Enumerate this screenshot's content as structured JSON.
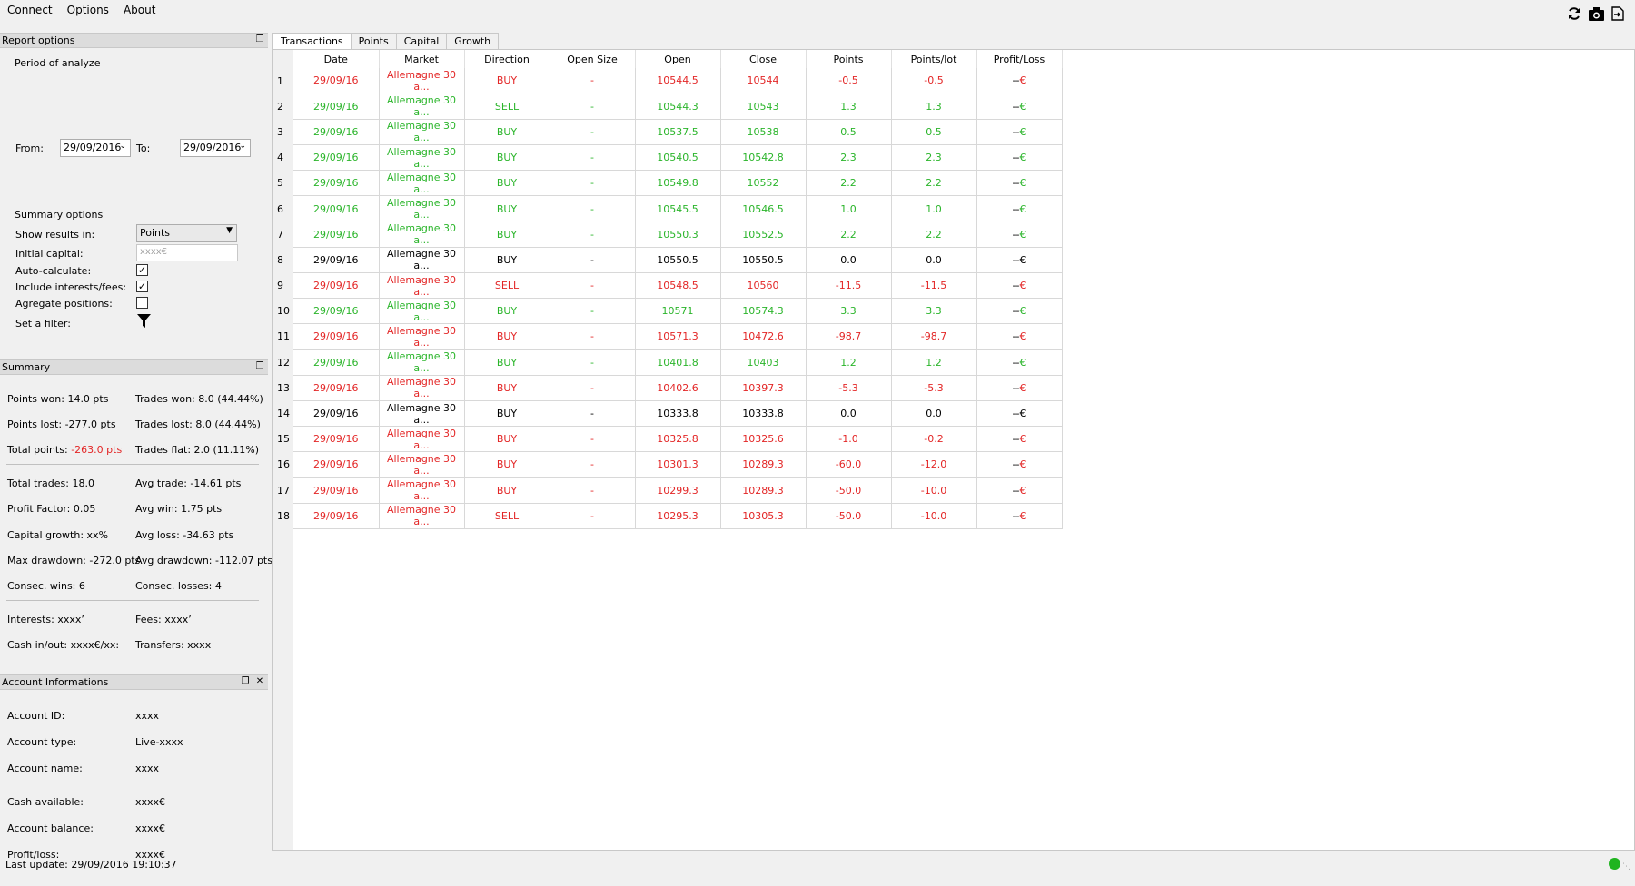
{
  "menu": [
    "Connect",
    "Options",
    "About"
  ],
  "toolbar": {
    "icons": [
      "refresh-icon",
      "camera-icon",
      "export-icon"
    ]
  },
  "report_options": {
    "title": "Report options",
    "period_label": "Period of analyze",
    "from_label": "From:",
    "from_value": "29/09/2016",
    "to_label": "To:",
    "to_value": "29/09/2016",
    "summary_options_label": "Summary options",
    "show_results_label": "Show results in:",
    "show_results_value": "Points",
    "initial_capital_label": "Initial capital:",
    "initial_capital_placeholder": "xxxx€",
    "auto_calculate_label": "Auto-calculate:",
    "auto_calculate_checked": true,
    "include_fees_label": "Include interests/fees:",
    "include_fees_checked": true,
    "aggregate_label": "Agregate positions:",
    "aggregate_checked": false,
    "filter_label": "Set a filter:"
  },
  "summary": {
    "title": "Summary",
    "points_won": "Points won: 14.0 pts",
    "trades_won": "Trades won: 8.0 (44.44%)",
    "points_lost": "Points lost: -277.0 pts",
    "trades_lost": "Trades lost: 8.0 (44.44%)",
    "total_points_label": "Total points: ",
    "total_points_value": "-263.0 pts",
    "trades_flat": "Trades flat: 2.0 (11.11%)",
    "total_trades": "Total trades: 18.0",
    "avg_trade": "Avg trade: -14.61 pts",
    "profit_factor": "Profit Factor: 0.05",
    "avg_win": "Avg win: 1.75 pts",
    "capital_growth": "Capital growth: xx%",
    "avg_loss": "Avg loss: -34.63 pts",
    "max_drawdown": "Max drawdown: -272.0 pts",
    "avg_drawdown": "Avg drawdown: -112.07 pts",
    "consec_wins": "Consec. wins: 6",
    "consec_losses": "Consec. losses: 4",
    "interests": "Interests: xxxx’",
    "fees": "Fees: xxxx’",
    "cash_inout": "Cash in/out: xxxx€/xx:",
    "transfers": "Transfers: xxxx"
  },
  "account": {
    "title": "Account Informations",
    "id_label": "Account ID:",
    "id_value": "xxxx",
    "type_label": "Account type:",
    "type_value": "Live-xxxx",
    "name_label": "Account name:",
    "name_value": "xxxx",
    "cash_label": "Cash available:",
    "cash_value": "xxxx€",
    "balance_label": "Account balance:",
    "balance_value": "xxxx€",
    "pl_label": "Profit/loss:",
    "pl_value": "xxxx€"
  },
  "last_update": "Last update: 29/09/2016 19:10:37",
  "tabs": [
    "Transactions",
    "Points",
    "Capital",
    "Growth"
  ],
  "table": {
    "columns": [
      "Date",
      "Market",
      "Direction",
      "Open Size",
      "Open",
      "Close",
      "Points",
      "Points/lot",
      "Profit/Loss"
    ],
    "rows": [
      {
        "n": "1",
        "cls": "red",
        "cells": [
          "29/09/16",
          "Allemagne 30 a...",
          "BUY",
          "-",
          "10544.5",
          "10544",
          "-0.5",
          "-0.5"
        ],
        "pl": "€"
      },
      {
        "n": "2",
        "cls": "green",
        "cells": [
          "29/09/16",
          "Allemagne 30 a...",
          "SELL",
          "-",
          "10544.3",
          "10543",
          "1.3",
          "1.3"
        ],
        "pl": "€"
      },
      {
        "n": "3",
        "cls": "green",
        "cells": [
          "29/09/16",
          "Allemagne 30 a...",
          "BUY",
          "-",
          "10537.5",
          "10538",
          "0.5",
          "0.5"
        ],
        "pl": "€"
      },
      {
        "n": "4",
        "cls": "green",
        "cells": [
          "29/09/16",
          "Allemagne 30 a...",
          "BUY",
          "-",
          "10540.5",
          "10542.8",
          "2.3",
          "2.3"
        ],
        "pl": "€"
      },
      {
        "n": "5",
        "cls": "green",
        "cells": [
          "29/09/16",
          "Allemagne 30 a...",
          "BUY",
          "-",
          "10549.8",
          "10552",
          "2.2",
          "2.2"
        ],
        "pl": "€"
      },
      {
        "n": "6",
        "cls": "green",
        "cells": [
          "29/09/16",
          "Allemagne 30 a...",
          "BUY",
          "-",
          "10545.5",
          "10546.5",
          "1.0",
          "1.0"
        ],
        "pl": "€"
      },
      {
        "n": "7",
        "cls": "green",
        "cells": [
          "29/09/16",
          "Allemagne 30 a...",
          "BUY",
          "-",
          "10550.3",
          "10552.5",
          "2.2",
          "2.2"
        ],
        "pl": "€"
      },
      {
        "n": "8",
        "cls": "black",
        "cells": [
          "29/09/16",
          "Allemagne 30 a...",
          "BUY",
          "-",
          "10550.5",
          "10550.5",
          "0.0",
          "0.0"
        ],
        "pl": "€"
      },
      {
        "n": "9",
        "cls": "red",
        "cells": [
          "29/09/16",
          "Allemagne 30 a...",
          "SELL",
          "-",
          "10548.5",
          "10560",
          "-11.5",
          "-11.5"
        ],
        "pl": "€"
      },
      {
        "n": "10",
        "cls": "green",
        "cells": [
          "29/09/16",
          "Allemagne 30 a...",
          "BUY",
          "-",
          "10571",
          "10574.3",
          "3.3",
          "3.3"
        ],
        "pl": "€"
      },
      {
        "n": "11",
        "cls": "red",
        "cells": [
          "29/09/16",
          "Allemagne 30 a...",
          "BUY",
          "-",
          "10571.3",
          "10472.6",
          "-98.7",
          "-98.7"
        ],
        "pl": "€"
      },
      {
        "n": "12",
        "cls": "green",
        "cells": [
          "29/09/16",
          "Allemagne 30 a...",
          "BUY",
          "-",
          "10401.8",
          "10403",
          "1.2",
          "1.2"
        ],
        "pl": "€"
      },
      {
        "n": "13",
        "cls": "red",
        "cells": [
          "29/09/16",
          "Allemagne 30 a...",
          "BUY",
          "-",
          "10402.6",
          "10397.3",
          "-5.3",
          "-5.3"
        ],
        "pl": "€"
      },
      {
        "n": "14",
        "cls": "black",
        "cells": [
          "29/09/16",
          "Allemagne 30 a...",
          "BUY",
          "-",
          "10333.8",
          "10333.8",
          "0.0",
          "0.0"
        ],
        "pl": "€"
      },
      {
        "n": "15",
        "cls": "red",
        "cells": [
          "29/09/16",
          "Allemagne 30 a...",
          "BUY",
          "-",
          "10325.8",
          "10325.6",
          "-1.0",
          "-0.2"
        ],
        "pl": "€"
      },
      {
        "n": "16",
        "cls": "red",
        "cells": [
          "29/09/16",
          "Allemagne 30 a...",
          "BUY",
          "-",
          "10301.3",
          "10289.3",
          "-60.0",
          "-12.0"
        ],
        "pl": "€"
      },
      {
        "n": "17",
        "cls": "red",
        "cells": [
          "29/09/16",
          "Allemagne 30 a...",
          "BUY",
          "-",
          "10299.3",
          "10289.3",
          "-50.0",
          "-10.0"
        ],
        "pl": "€"
      },
      {
        "n": "18",
        "cls": "red",
        "cells": [
          "29/09/16",
          "Allemagne 30 a...",
          "SELL",
          "-",
          "10295.3",
          "10305.3",
          "-50.0",
          "-10.0"
        ],
        "pl": "€"
      }
    ]
  },
  "colors": {
    "green": "#2bb52b",
    "red": "#e32626",
    "status": "#1fb41f"
  }
}
